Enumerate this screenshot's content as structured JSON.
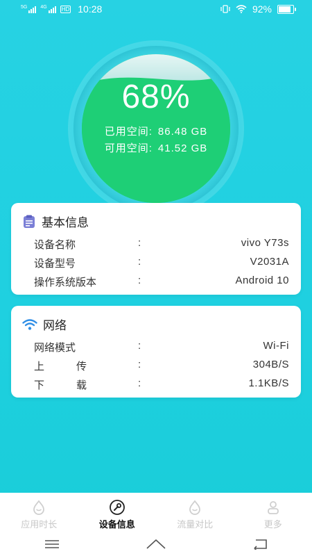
{
  "status_bar": {
    "sim1_label": "5G",
    "sim2_label": "4G",
    "hd_label": "HD",
    "time": "10:28",
    "battery": "92%",
    "battery_level": 0.92
  },
  "storage": {
    "percent": "68%",
    "percent_value": 0.68,
    "used_label": "已用空间:",
    "used_value": "86.48 GB",
    "free_label": "可用空间:",
    "free_value": "41.52 GB"
  },
  "basic_info": {
    "title": "基本信息",
    "rows": [
      {
        "key": "设备名称",
        "colon": ":",
        "value": "vivo Y73s"
      },
      {
        "key": "设备型号",
        "colon": ":",
        "value": "V2031A"
      },
      {
        "key": "操作系统版本",
        "colon": ":",
        "value": "Android 10"
      }
    ]
  },
  "network": {
    "title": "网络",
    "rows": [
      {
        "key": "网络模式",
        "colon": ":",
        "value": "Wi-Fi"
      },
      {
        "key": "上传",
        "colon": ":",
        "value": "304B/S"
      },
      {
        "key": "下载",
        "colon": ":",
        "value": "1.1KB/S"
      }
    ]
  },
  "nav": {
    "items": [
      {
        "label": "应用时长",
        "icon": "drop-icon"
      },
      {
        "label": "设备信息",
        "icon": "wrench-icon"
      },
      {
        "label": "流量对比",
        "icon": "drop-icon"
      },
      {
        "label": "更多",
        "icon": "person-icon"
      }
    ],
    "active_index": 1
  },
  "colors": {
    "background": "#1fd0e0",
    "gauge_fill": "#1fd07a",
    "wave_light": "#c8ecea",
    "card_icon_purple": "#7b7fd6",
    "wifi_blue": "#2f8ee6"
  }
}
